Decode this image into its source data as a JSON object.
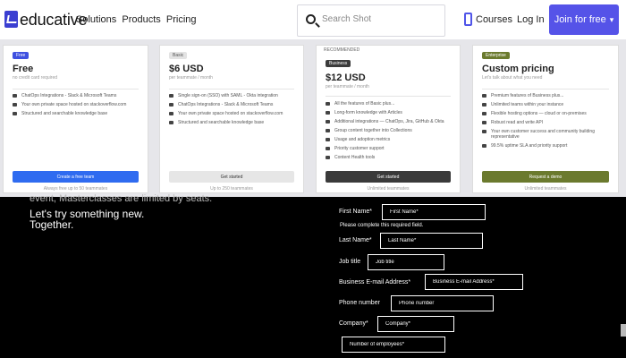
{
  "nav": {
    "logo_text": "educative",
    "links": "Solutions  Products  Pricing",
    "search_placeholder": "Search Shot",
    "courses_label": "Courses",
    "login_label": "Log In",
    "join_label": "Join for free",
    "accent": "#5553e8"
  },
  "plans": [
    {
      "badge": "Free",
      "name": "Free",
      "subtitle": "no credit card required",
      "features": [
        "ChatOps Integrations - Slack & Microsoft Teams",
        "Your own private space hosted on stackoverflow.com",
        "Structured and searchable knowledge base"
      ],
      "cta": "Create a free team",
      "footer": "Always free up to 50 teammates"
    },
    {
      "badge": "Basic",
      "name": "$6 USD",
      "subtitle": "per teammate / month",
      "features": [
        "Single sign-on (SSO) with SAML - Okta integration",
        "ChatOps Integrations - Slack & Microsoft Teams",
        "Your own private space hosted on stackoverflow.com",
        "Structured and searchable knowledge base"
      ],
      "cta": "Get started",
      "footer": "Up to 250 teammates"
    },
    {
      "recommended": "RECOMMENDED",
      "badge": "Business",
      "name": "$12 USD",
      "subtitle": "per teammate / month",
      "features": [
        "All the features of Basic plus...",
        "Long-form knowledge with Articles",
        "Additional integrations — ChatOps, Jira, GitHub & Okta",
        "Group content together into Collections",
        "Usage and adoption metrics",
        "Priority customer support",
        "Content Health tools"
      ],
      "cta": "Get started",
      "footer": "Unlimited teammates"
    },
    {
      "badge": "Enterprise",
      "name": "Custom pricing",
      "subtitle": "Let's talk about what you need",
      "features": [
        "Premium features of Business plus...",
        "Unlimited teams within your instance",
        "Flexible hosting options — cloud or on-premises",
        "Robust read and write API",
        "Your own customer success and community building representative",
        "99.5% uptime SLA and priority support"
      ],
      "cta": "Request a demo",
      "footer": "Unlimited teammates"
    }
  ],
  "contact": {
    "limited_note": "event, Masterclasses are limited by seats.",
    "tagline_1": "Let's try something new.",
    "tagline_2": "Together.",
    "required_msg": "Please complete this required field.",
    "fields": [
      {
        "label": "First Name*",
        "placeholder": "First Name*"
      },
      {
        "label": "Last Name*",
        "placeholder": "Last Name*"
      },
      {
        "label": "Job title",
        "placeholder": "Job title"
      },
      {
        "label": "Business E-mail Address*",
        "placeholder": "Business E-mail Address*"
      },
      {
        "label": "Phone number",
        "placeholder": "Phone number"
      },
      {
        "label": "Company*",
        "placeholder": "Company*"
      },
      {
        "label": "",
        "placeholder": "Number of employees*"
      }
    ]
  }
}
